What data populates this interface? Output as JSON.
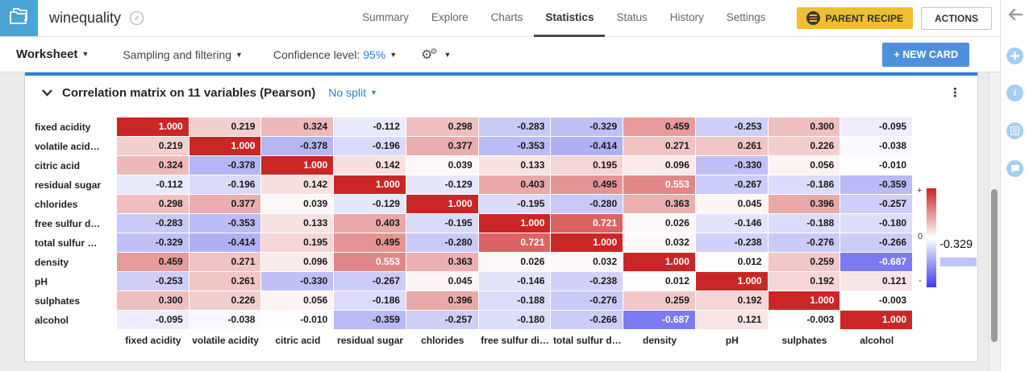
{
  "header": {
    "app_title": "winequality",
    "nav_tabs": [
      {
        "label": "Summary",
        "active": false
      },
      {
        "label": "Explore",
        "active": false
      },
      {
        "label": "Charts",
        "active": false
      },
      {
        "label": "Statistics",
        "active": true
      },
      {
        "label": "Status",
        "active": false
      },
      {
        "label": "History",
        "active": false
      },
      {
        "label": "Settings",
        "active": false
      }
    ],
    "parent_recipe_label": "PARENT RECIPE",
    "actions_label": "ACTIONS"
  },
  "toolbar": {
    "worksheet_label": "Worksheet",
    "sampling_filtering_label": "Sampling and filtering",
    "confidence_label": "Confidence level:",
    "confidence_value": "95%",
    "new_card_label": "+ NEW CARD"
  },
  "card": {
    "title": "Correlation matrix on 11 variables (Pearson)",
    "split_label": "No split",
    "kebab": "⋮"
  },
  "chart_data": {
    "type": "heatmap",
    "title": "Correlation matrix on 11 variables (Pearson)",
    "method": "Pearson",
    "variables_count": 11,
    "row_labels": [
      "fixed acidity",
      "volatile acid…",
      "citric acid",
      "residual sugar",
      "chlorides",
      "free sulfur d…",
      "total sulfur …",
      "density",
      "pH",
      "sulphates",
      "alcohol"
    ],
    "col_labels": [
      "fixed acidity",
      "volatile acidity",
      "citric acid",
      "residual sugar",
      "chlorides",
      "free sulfur di…",
      "total sulfur d…",
      "density",
      "pH",
      "sulphates",
      "alcohol"
    ],
    "matrix": [
      [
        1.0,
        0.219,
        0.324,
        -0.112,
        0.298,
        -0.283,
        -0.329,
        0.459,
        -0.253,
        0.3,
        -0.095
      ],
      [
        0.219,
        1.0,
        -0.378,
        -0.196,
        0.377,
        -0.353,
        -0.414,
        0.271,
        0.261,
        0.226,
        -0.038
      ],
      [
        0.324,
        -0.378,
        1.0,
        0.142,
        0.039,
        0.133,
        0.195,
        0.096,
        -0.33,
        0.056,
        -0.01
      ],
      [
        -0.112,
        -0.196,
        0.142,
        1.0,
        -0.129,
        0.403,
        0.495,
        0.553,
        -0.267,
        -0.186,
        -0.359
      ],
      [
        0.298,
        0.377,
        0.039,
        -0.129,
        1.0,
        -0.195,
        -0.28,
        0.363,
        0.045,
        0.396,
        -0.257
      ],
      [
        -0.283,
        -0.353,
        0.133,
        0.403,
        -0.195,
        1.0,
        0.721,
        0.026,
        -0.146,
        -0.188,
        -0.18
      ],
      [
        -0.329,
        -0.414,
        0.195,
        0.495,
        -0.28,
        0.721,
        1.0,
        0.032,
        -0.238,
        -0.276,
        -0.266
      ],
      [
        0.459,
        0.271,
        0.096,
        0.553,
        0.363,
        0.026,
        0.032,
        1.0,
        0.012,
        0.259,
        -0.687
      ],
      [
        -0.253,
        0.261,
        -0.33,
        -0.267,
        0.045,
        -0.146,
        -0.238,
        0.012,
        1.0,
        0.192,
        0.121
      ],
      [
        0.3,
        0.226,
        0.056,
        -0.186,
        0.396,
        -0.188,
        -0.276,
        0.259,
        0.192,
        1.0,
        -0.003
      ],
      [
        -0.095,
        -0.038,
        -0.01,
        -0.359,
        -0.257,
        -0.18,
        -0.266,
        -0.687,
        0.121,
        -0.003,
        1.0
      ]
    ],
    "value_decimals": 3,
    "color_scale": {
      "positive_max": "#cb2626",
      "zero": "#ffffff",
      "negative_max": "#3f3fe8",
      "white_text_threshold": 0.55
    },
    "legend": {
      "plus_label": "+",
      "zero_label": "0",
      "minus_label": "-",
      "marker_value": "-0.329",
      "marker_color": "#bec3f8",
      "position": "right"
    }
  },
  "colors": {
    "logo_bg": "#4ba3d6",
    "accent_blue": "#2a7fe0",
    "card_top_bar": "#2e7fe0",
    "parent_recipe_bg": "#eebf2e",
    "new_card_bg": "#4f90dd",
    "content_bg": "#ebebeb",
    "active_tab_underline": "#4a4a4a"
  },
  "right_rail_icons": [
    "back-arrow-icon",
    "add-icon",
    "info-icon",
    "list-icon",
    "chat-icon"
  ]
}
